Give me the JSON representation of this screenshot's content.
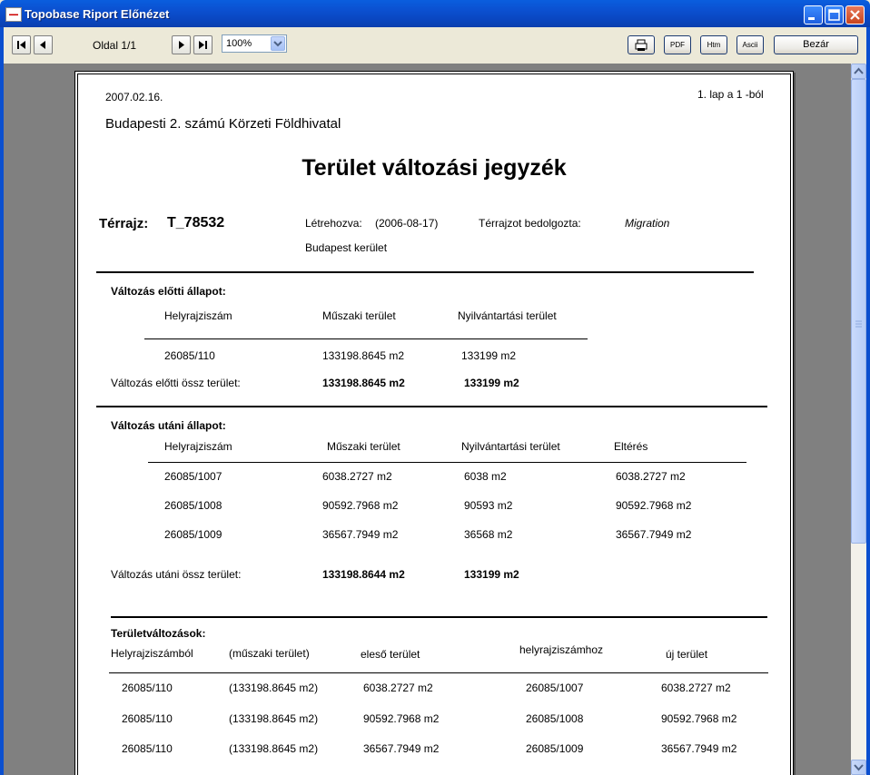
{
  "window": {
    "title": "Topobase Riport Előnézet"
  },
  "toolbar": {
    "page_label": "Oldal 1/1",
    "zoom": "100%",
    "pdf_label": "PDF",
    "htm_label": "Htm",
    "ascii_label": "Ascii",
    "close_label": "Bezár"
  },
  "report": {
    "date": "2007.02.16.",
    "page_counter": "1. lap a 1 -ból",
    "office": "Budapesti 2. számú Körzeti Földhivatal",
    "title": "Terület változási jegyzék",
    "map_label": "Térrajz:",
    "map_id": "T_78532",
    "created_label": "Létrehozva:",
    "created_value": "(2006-08-17)",
    "processed_label": "Térrajzot bedolgozta:",
    "processed_value": "Migration",
    "location": "Budapest  kerület",
    "before": {
      "heading": "Változás előtti állapot:",
      "cols": [
        "Helyrajziszám",
        "Műszaki terület",
        "Nyilvántartási terület"
      ],
      "row": [
        "26085/110",
        "133198.8645 m2",
        "133199 m2"
      ],
      "total_label": "Változás előtti össz terület:",
      "total_tech": "133198.8645 m2",
      "total_reg": "133199 m2"
    },
    "after": {
      "heading": "Változás utáni állapot:",
      "cols": [
        "Helyrajziszám",
        "Műszaki terület",
        "Nyilvántartási terület",
        "Eltérés"
      ],
      "rows": [
        [
          "26085/1007",
          "6038.2727  m2",
          "6038 m2",
          "6038.2727   m2"
        ],
        [
          "26085/1008",
          "90592.7968 m2",
          "90593 m2",
          "90592.7968  m2"
        ],
        [
          "26085/1009",
          "36567.7949 m2",
          "36568 m2",
          "36567.7949  m2"
        ]
      ],
      "total_label": "Változás utáni össz terület:",
      "total_tech": "133198.8644 m2",
      "total_reg": "133199 m2"
    },
    "changes": {
      "heading": "Területváltozások:",
      "cols": [
        "Helyrajziszámból",
        "(műszaki terület)",
        "eleső terület",
        "helyrajziszámhoz",
        "új terület"
      ],
      "rows": [
        [
          "26085/110",
          "(133198.8645 m2)",
          "6038.2727  m2",
          "26085/1007",
          "6038.2727 m2"
        ],
        [
          "26085/110",
          "(133198.8645 m2)",
          "90592.7968 m2",
          "26085/1008",
          "90592.7968 m2"
        ],
        [
          "26085/110",
          "(133198.8645 m2)",
          "36567.7949 m2",
          "26085/1009",
          "36567.7949 m2"
        ]
      ]
    }
  }
}
